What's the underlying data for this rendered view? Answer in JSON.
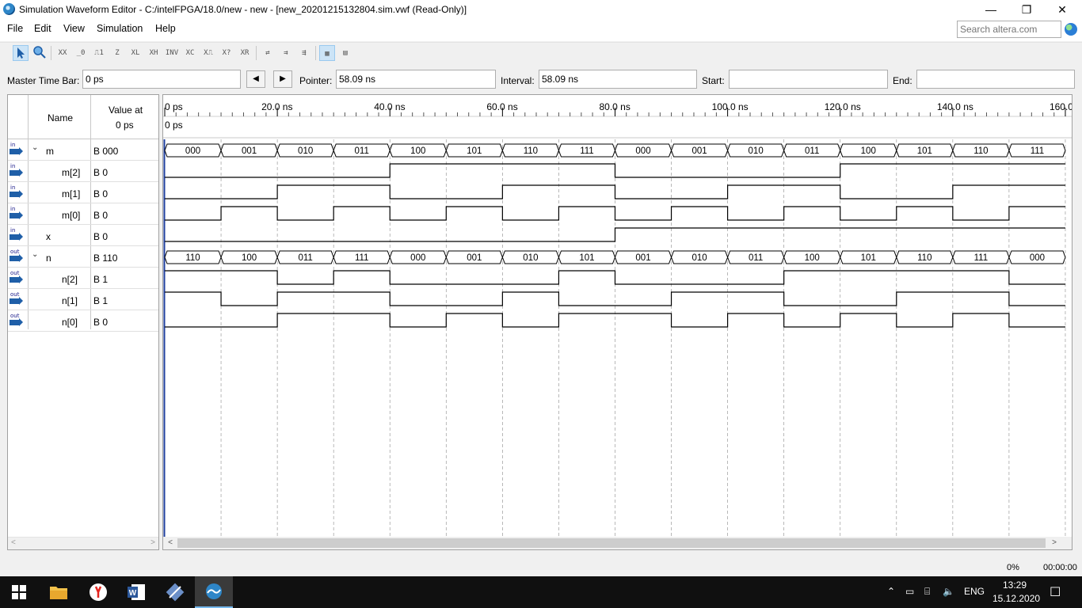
{
  "window": {
    "title": "Simulation Waveform Editor - C:/intelFPGA/18.0/new - new - [new_20201215132804.sim.vwf (Read-Only)]",
    "minimize": "—",
    "maximize": "❐",
    "close": "✕"
  },
  "menu": {
    "items": [
      "File",
      "Edit",
      "View",
      "Simulation",
      "Help"
    ],
    "search_placeholder": "Search altera.com"
  },
  "toolbar": {
    "buttons": [
      "select-icon",
      "zoom-icon",
      "unknown-value-icon",
      "force-low-icon",
      "force-high-icon",
      "high-impedance-icon",
      "weak-low-icon",
      "weak-high-icon",
      "invert-icon",
      "count-value-icon",
      "clock-icon",
      "arbitrary-value-icon",
      "random-value-icon",
      "snap-icon",
      "overwrite-icon",
      "grid-icon",
      "expand-icon"
    ]
  },
  "timebar": {
    "master_label": "Master Time Bar:",
    "master_value": "0 ps",
    "prev": "◀",
    "next": "▶",
    "pointer_label": "Pointer:",
    "pointer_value": "58.09 ns",
    "interval_label": "Interval:",
    "interval_value": "58.09 ns",
    "start_label": "Start:",
    "start_value": "",
    "end_label": "End:",
    "end_value": ""
  },
  "signal_table": {
    "name_header": "Name",
    "value_header_line1": "Value at",
    "value_header_line2": "0 ps",
    "rows": [
      {
        "dir": "in",
        "name": "m",
        "value": "B 000",
        "group": true
      },
      {
        "dir": "in",
        "name": "m[2]",
        "value": "B 0",
        "group": false
      },
      {
        "dir": "in",
        "name": "m[1]",
        "value": "B 0",
        "group": false
      },
      {
        "dir": "in",
        "name": "m[0]",
        "value": "B 0",
        "group": false
      },
      {
        "dir": "in",
        "name": "x",
        "value": "B 0",
        "group": false
      },
      {
        "dir": "out",
        "name": "n",
        "value": "B 110",
        "group": true
      },
      {
        "dir": "out",
        "name": "n[2]",
        "value": "B 1",
        "group": false
      },
      {
        "dir": "out",
        "name": "n[1]",
        "value": "B 1",
        "group": false
      },
      {
        "dir": "out",
        "name": "n[0]",
        "value": "B 0",
        "group": false
      }
    ]
  },
  "waveform": {
    "time_labels": [
      "0 ps",
      "20.0 ns",
      "40.0 ns",
      "60.0 ns",
      "80.0 ns",
      "100.0 ns",
      "120.0 ns",
      "140.0 ns",
      "160.0 ns"
    ],
    "marker_label": "0 ps",
    "segment_ns": 10,
    "m_bus": [
      "000",
      "001",
      "010",
      "011",
      "100",
      "101",
      "110",
      "111",
      "000",
      "001",
      "010",
      "011",
      "100",
      "101",
      "110",
      "111"
    ],
    "m2": [
      0,
      0,
      0,
      0,
      1,
      1,
      1,
      1,
      0,
      0,
      0,
      0,
      1,
      1,
      1,
      1
    ],
    "m1": [
      0,
      0,
      1,
      1,
      0,
      0,
      1,
      1,
      0,
      0,
      1,
      1,
      0,
      0,
      1,
      1
    ],
    "m0": [
      0,
      1,
      0,
      1,
      0,
      1,
      0,
      1,
      0,
      1,
      0,
      1,
      0,
      1,
      0,
      1
    ],
    "x": [
      0,
      0,
      0,
      0,
      0,
      0,
      0,
      0,
      1,
      1,
      1,
      1,
      1,
      1,
      1,
      1
    ],
    "n_bus": [
      "110",
      "100",
      "011",
      "111",
      "000",
      "001",
      "010",
      "101",
      "001",
      "010",
      "011",
      "100",
      "101",
      "110",
      "111",
      "000"
    ],
    "n2": [
      1,
      1,
      0,
      1,
      0,
      0,
      0,
      1,
      0,
      0,
      0,
      1,
      1,
      1,
      1,
      0
    ],
    "n1": [
      1,
      0,
      1,
      1,
      0,
      0,
      1,
      0,
      0,
      1,
      1,
      0,
      0,
      1,
      1,
      0
    ],
    "n0": [
      0,
      0,
      1,
      1,
      0,
      1,
      0,
      1,
      1,
      0,
      1,
      0,
      1,
      0,
      1,
      0
    ]
  },
  "status": {
    "progress": "0%",
    "elapsed": "00:00:00"
  },
  "taskbar": {
    "language": "ENG",
    "time": "13:29",
    "date": "15.12.2020"
  }
}
